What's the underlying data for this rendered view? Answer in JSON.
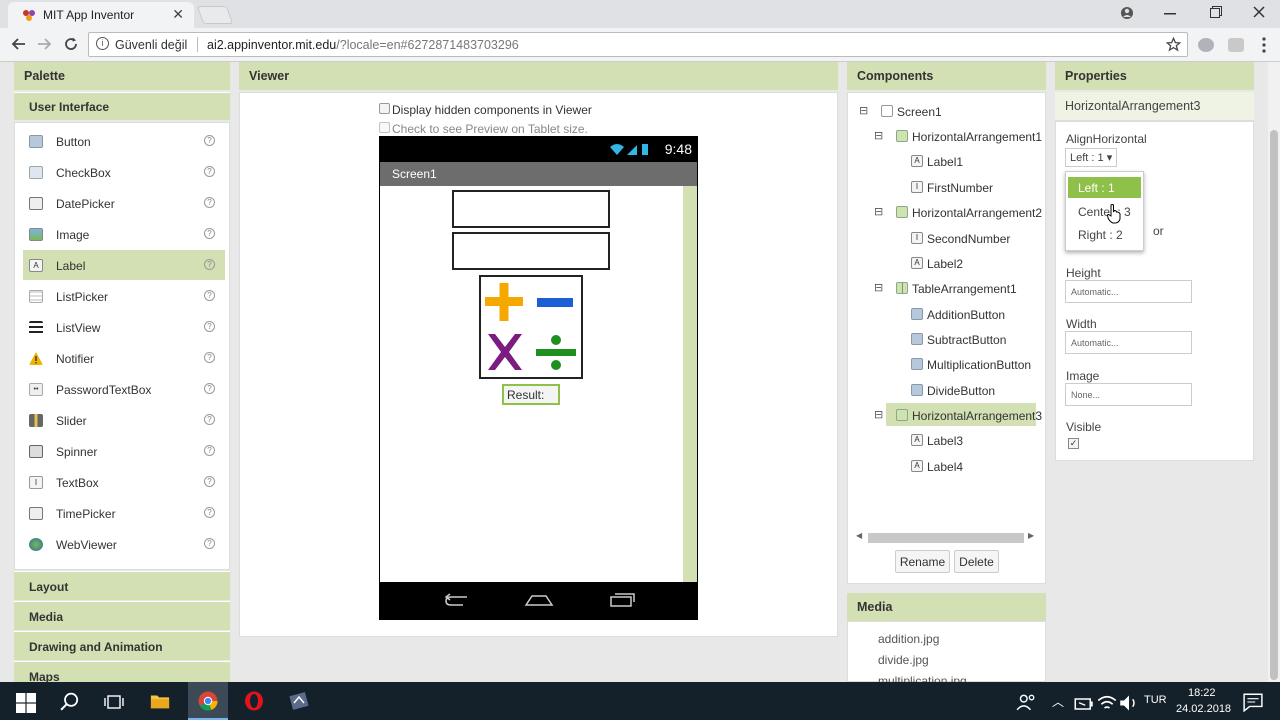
{
  "browser": {
    "tab_title": "MIT App Inventor",
    "close_glyph": "✕",
    "security_label": "Güvenli değil",
    "url_host": "ai2.appinventor.mit.edu",
    "url_rest": "/?locale=en#6272871483703296"
  },
  "palette": {
    "header": "Palette",
    "category": "User Interface",
    "items": [
      {
        "label": "Button"
      },
      {
        "label": "CheckBox"
      },
      {
        "label": "DatePicker"
      },
      {
        "label": "Image"
      },
      {
        "label": "Label"
      },
      {
        "label": "ListPicker"
      },
      {
        "label": "ListView"
      },
      {
        "label": "Notifier"
      },
      {
        "label": "PasswordTextBox"
      },
      {
        "label": "Slider"
      },
      {
        "label": "Spinner"
      },
      {
        "label": "TextBox"
      },
      {
        "label": "TimePicker"
      },
      {
        "label": "WebViewer"
      }
    ],
    "selected_item": "Label",
    "other_categories": [
      "Layout",
      "Media",
      "Drawing and Animation",
      "Maps"
    ]
  },
  "viewer": {
    "header": "Viewer",
    "display_hidden": "Display hidden components in Viewer",
    "tablet_preview": "Check to see Preview on Tablet size.",
    "phone_time": "9:48",
    "screen_title": "Screen1",
    "result_label": "Result:"
  },
  "components": {
    "header": "Components",
    "tree": [
      {
        "label": "Screen1"
      },
      {
        "label": "HorizontalArrangement1"
      },
      {
        "label": "Label1"
      },
      {
        "label": "FirstNumber"
      },
      {
        "label": "HorizontalArrangement2"
      },
      {
        "label": "SecondNumber"
      },
      {
        "label": "Label2"
      },
      {
        "label": "TableArrangement1"
      },
      {
        "label": "AdditionButton"
      },
      {
        "label": "SubtractButton"
      },
      {
        "label": "MultiplicationButton"
      },
      {
        "label": "DivideButton"
      },
      {
        "label": "HorizontalArrangement3"
      },
      {
        "label": "Label3"
      },
      {
        "label": "Label4"
      }
    ],
    "selected": "HorizontalArrangement3",
    "rename_button": "Rename",
    "delete_button": "Delete"
  },
  "media": {
    "header": "Media",
    "files": [
      "addition.jpg",
      "divide.jpg",
      "multiplication.jpg"
    ]
  },
  "properties": {
    "header": "Properties",
    "component": "HorizontalArrangement3",
    "align_horizontal_label": "AlignHorizontal",
    "align_horizontal_value": "Left : 1 ▾",
    "dropdown_options": [
      "Left : 1",
      "Center : 3",
      "Right : 2"
    ],
    "selected_option": "Left : 1",
    "hidden_label_tail": "or",
    "height_label": "Height",
    "height_value": "Automatic...",
    "width_label": "Width",
    "width_value": "Automatic...",
    "image_label": "Image",
    "image_value": "None...",
    "visible_label": "Visible",
    "visible_checked": true
  },
  "taskbar": {
    "language": "TUR",
    "time": "18:22",
    "date": "24.02.2018"
  },
  "colors": {
    "panel_header": "#d2e0b4",
    "selection": "#8fc04a",
    "taskbar": "#14212b"
  }
}
